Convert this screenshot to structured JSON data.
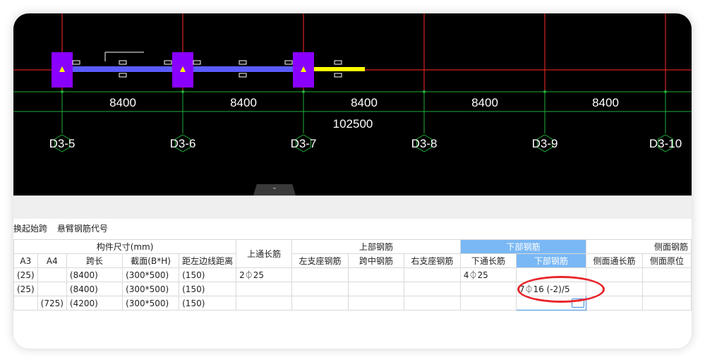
{
  "canvas": {
    "dims": [
      "8400",
      "8400",
      "8400",
      "8400",
      "8400"
    ],
    "total_dim": "102500",
    "axes": [
      "D3-5",
      "D3-6",
      "D3-7",
      "D3-8",
      "D3-9",
      "D3-10"
    ],
    "colors": {
      "background": "#000000",
      "column": "#8a00ff",
      "beam": "#5a5cff",
      "beam_selected": "#ffff00",
      "axis_red": "#ff2a2a",
      "axis_green": "#1fae3a",
      "support_marker": "#ffff00"
    }
  },
  "panel": {
    "collapse_icon": "chevron-down-icon",
    "menu": [
      "换起始跨",
      "悬臂钢筋代号"
    ]
  },
  "table": {
    "group_headers": {
      "component_size": "构件尺寸(mm)",
      "top_through": "上通长筋",
      "top_rebar": "上部钢筋",
      "bottom_rebar": "下部钢筋",
      "side_rebar": "侧面钢筋"
    },
    "sub_headers": {
      "a3": "A3",
      "a4": "A4",
      "span_length": "跨长",
      "section": "截面(B*H)",
      "edge_dist": "距左边线距离",
      "left_support": "左支座钢筋",
      "mid_span": "跨中钢筋",
      "right_support": "右支座钢筋",
      "bottom_through": "下通长筋",
      "bottom_rebar": "下部钢筋",
      "side_through": "侧面通长筋",
      "side_original": "侧面原位"
    },
    "rows": [
      {
        "a3": "(25)",
        "a4": "",
        "span": "(8400)",
        "section": "(300*500)",
        "edge": "(150)",
        "top_through": "2⏀25",
        "left": "",
        "mid": "",
        "right": "",
        "bottom_through": "4⏀25",
        "bottom": "",
        "side_through": "",
        "side_orig": ""
      },
      {
        "a3": "(25)",
        "a4": "",
        "span": "(8400)",
        "section": "(300*500)",
        "edge": "(150)",
        "top_through": "",
        "left": "",
        "mid": "",
        "right": "",
        "bottom_through": "",
        "bottom": "7⏀16 (-2)/5",
        "side_through": "",
        "side_orig": ""
      },
      {
        "a3": "",
        "a4": "(725)",
        "span": "(4200)",
        "section": "(300*500)",
        "edge": "(150)",
        "top_through": "",
        "left": "",
        "mid": "",
        "right": "",
        "bottom_through": "",
        "bottom": "",
        "side_through": "",
        "side_orig": ""
      }
    ],
    "annotation_color": "#e8262b"
  }
}
